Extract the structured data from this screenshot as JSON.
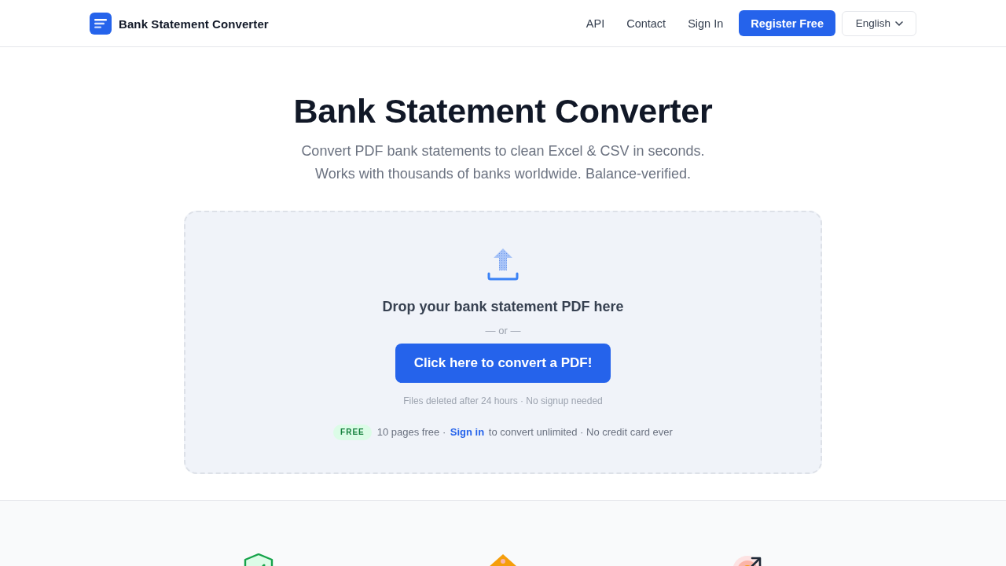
{
  "header": {
    "brand": "Bank Statement Converter",
    "nav_links": [
      "API",
      "Contact",
      "Sign In"
    ],
    "register_button": "Register Free",
    "language": "English"
  },
  "hero": {
    "title": "Bank Statement Converter",
    "subtitle": [
      "Convert PDF bank statements to clean Excel & CSV in seconds.",
      "Works with thousands of banks worldwide. Balance-verified."
    ]
  },
  "dropzone": {
    "prompt": "Drop your bank statement PDF here",
    "separator": "— or —",
    "button": "Click here to convert a PDF!",
    "note": "Files deleted after 24 hours · No signup needed",
    "free_badge": "FREE",
    "free_text_before": "10 pages free ·",
    "free_link": "Sign in",
    "free_text_after": "to convert unlimited · No credit card ever"
  },
  "features": [
    {
      "kind": "shield"
    },
    {
      "kind": "tag"
    },
    {
      "kind": "target"
    }
  ]
}
